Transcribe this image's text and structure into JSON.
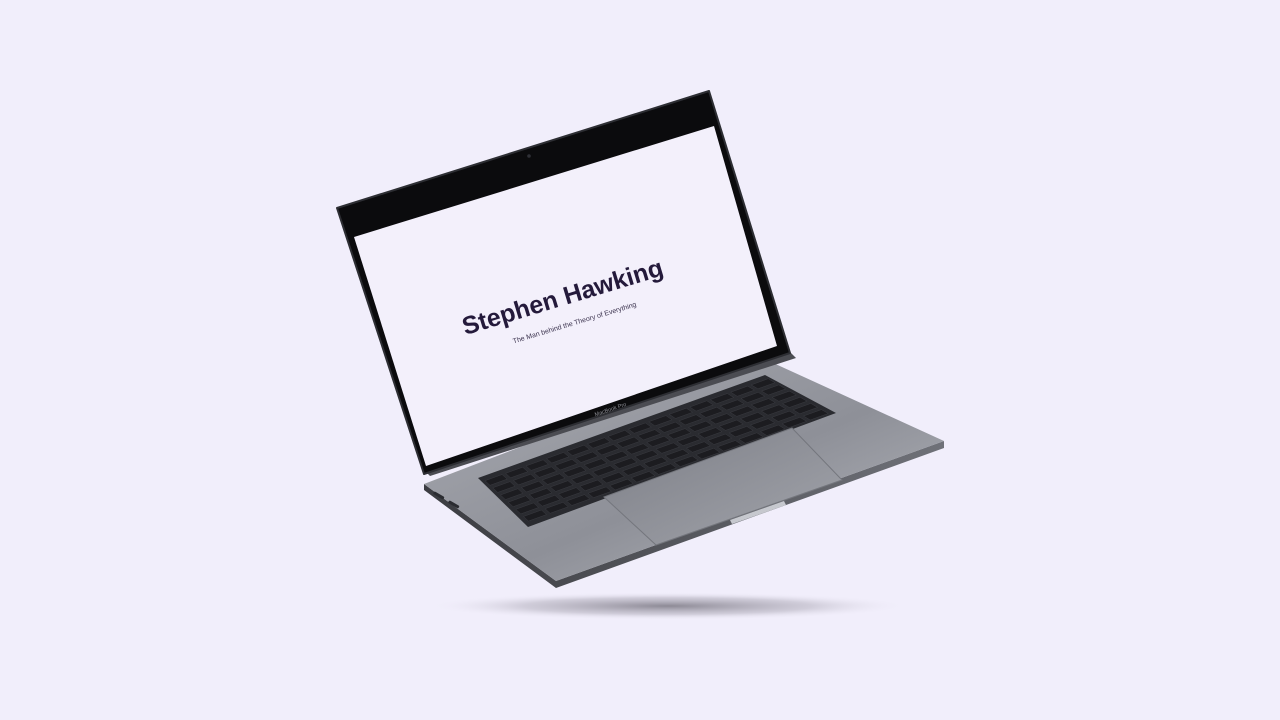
{
  "page": {
    "background": "#f1eefb"
  },
  "laptop": {
    "model_label": "MacBook Pro",
    "screen": {
      "background": "#f3f0fb",
      "title": "Stephen Hawking",
      "subtitle": "The Man behind the Theory of Everything",
      "title_color": "#241a3b",
      "subtitle_color": "#3d3550"
    },
    "colors": {
      "bezel": "#0b0b0d",
      "body": "#9a9ca4",
      "keyboard_well": "#2a2b30",
      "key": "#1c1c20",
      "trackpad": "#8b8d95"
    }
  }
}
